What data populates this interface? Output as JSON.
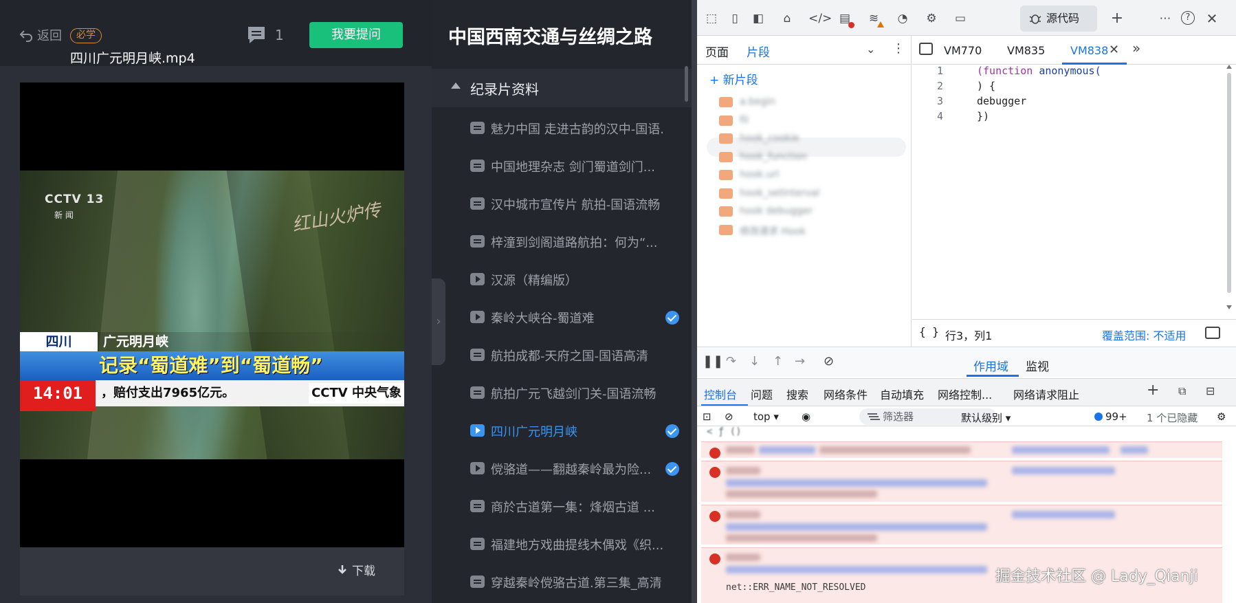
{
  "player": {
    "back_label": "返回",
    "required_badge": "必学",
    "comment_count": "1",
    "ask_button": "我要提问",
    "file_name": "四川广元明月峡.mp4",
    "download_label": "下载",
    "video_overlay": {
      "channel_logo": "CCTV 13",
      "channel_sub": "新 闻",
      "program_logo": "红山火炉传",
      "province": "四川",
      "place": "广元明月峡",
      "headline": "记录“蜀道难”到“蜀道畅”",
      "time": "14:01",
      "ticker": "，赔付支出7965亿元。",
      "ticker_brand": "CCTV 中央气象"
    }
  },
  "course": {
    "title": "中国西南交通与丝绸之路",
    "section": "纪录片资料",
    "lessons": [
      {
        "title": "魅力中国 走进古韵的汉中-国语...",
        "icon": "doc-icon",
        "done": false,
        "active": false
      },
      {
        "title": "中国地理杂志 剑门蜀道剑门...",
        "icon": "doc-icon",
        "done": false,
        "active": false
      },
      {
        "title": "汉中城市宣传片 航拍-国语流畅",
        "icon": "doc-icon",
        "done": false,
        "active": false
      },
      {
        "title": "梓潼到剑阁道路航拍：何为“...",
        "icon": "doc-icon",
        "done": false,
        "active": false
      },
      {
        "title": "汉源（精编版）",
        "icon": "play-icon",
        "done": false,
        "active": false
      },
      {
        "title": "秦岭大峡谷-蜀道难",
        "icon": "play-icon",
        "done": true,
        "active": false
      },
      {
        "title": "航拍成都-天府之国-国语高清",
        "icon": "doc-icon",
        "done": false,
        "active": false
      },
      {
        "title": "航拍广元飞越剑门关-国语流畅",
        "icon": "doc-icon",
        "done": false,
        "active": false
      },
      {
        "title": "四川广元明月峡",
        "icon": "play-icon",
        "done": true,
        "active": true
      },
      {
        "title": "傥骆道——翻越秦岭最为险...",
        "icon": "play-icon",
        "done": true,
        "active": false
      },
      {
        "title": "商於古道第一集：烽烟古道 ...",
        "icon": "doc-icon",
        "done": false,
        "active": false
      },
      {
        "title": "福建地方戏曲提线木偶戏《织...",
        "icon": "doc-icon",
        "done": false,
        "active": false
      },
      {
        "title": "穿越秦岭傥骆古道.第三集_高清",
        "icon": "doc-icon",
        "done": false,
        "active": false
      }
    ]
  },
  "devtools": {
    "sources_tab": "源代码",
    "nav_tabs": {
      "page": "页面",
      "snippets": "片段"
    },
    "new_snippet": "新片段",
    "snippets": [
      "a.begin",
      "fil",
      "hook_cookie",
      "hook_function",
      "hook.url",
      "hook_setInterval",
      "hook debugger",
      "修改请求 Hook"
    ],
    "editor_tabs": [
      "VM770",
      "VM835",
      "VM838"
    ],
    "code": [
      {
        "n": "1",
        "text": "(function anonymous("
      },
      {
        "n": "2",
        "text": ") {"
      },
      {
        "n": "3",
        "text": "debugger"
      },
      {
        "n": "4",
        "text": "})"
      }
    ],
    "status": {
      "braces": "{ }",
      "position": "行3，列1",
      "coverage": "覆盖范围: 不适用"
    },
    "debug_tabs": {
      "scope": "作用域",
      "watch": "监视"
    },
    "drawer_tabs": [
      "控制台",
      "问题",
      "搜索",
      "网络条件",
      "自动填充",
      "网络控制...",
      "网络请求阻止"
    ],
    "console_toolbar": {
      "context": "top",
      "filter_placeholder": "筛选器",
      "level": "默认级别",
      "issues": "99+",
      "hidden": "1 个已隐藏"
    },
    "console_first_line": "< ƒ ()",
    "console_last_line": "net::ERR_NAME_NOT_RESOLVED"
  },
  "watermark": "掘金技术社区 @ Lady_Qianji"
}
